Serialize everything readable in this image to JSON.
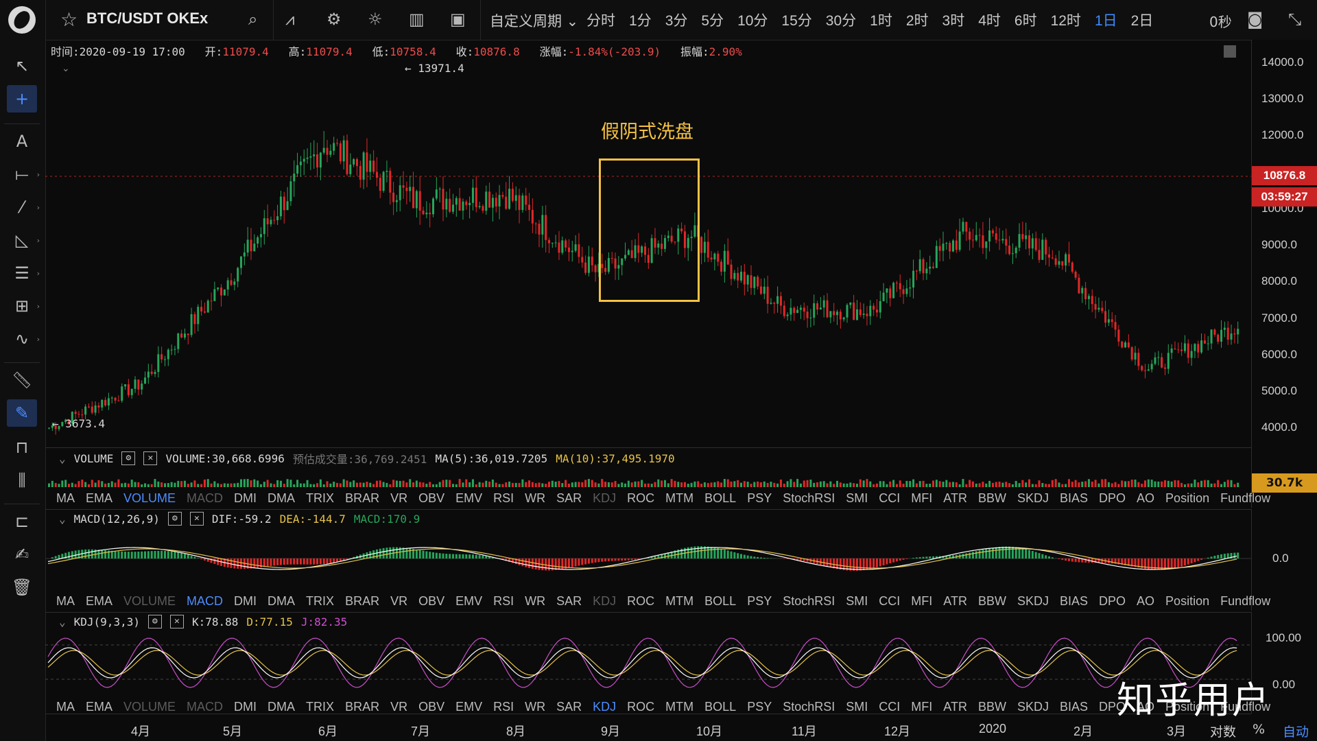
{
  "header": {
    "symbol": "BTC/USDT OKEx",
    "custom_period": "自定义周期 ⌄",
    "periods": [
      "分时",
      "1分",
      "3分",
      "5分",
      "10分",
      "15分",
      "30分",
      "1时",
      "2时",
      "3时",
      "4时",
      "6时",
      "12时",
      "1日",
      "2日"
    ],
    "active_period": "1日",
    "countdown": "0秒"
  },
  "info": {
    "time_label": "时间:",
    "time": "2020-09-19 17:00",
    "open_label": "开:",
    "open": "11079.4",
    "high_label": "高:",
    "high": "11079.4",
    "low_label": "低:",
    "low": "10758.4",
    "close_label": "收:",
    "close": "10876.8",
    "change_label": "涨幅:",
    "change": "-1.84%(-203.9)",
    "amp_label": "振幅:",
    "amp": "2.90%"
  },
  "main": {
    "high_marker": "← 13971.4",
    "low_marker": "← 3673.4",
    "annotation": "假阴式洗盘",
    "price_ticks": [
      "14000.0",
      "13000.0",
      "12000.0",
      "11000.0",
      "10000.0",
      "9000.0",
      "8000.0",
      "7000.0",
      "6000.0",
      "5000.0",
      "4000.0"
    ],
    "last_price": "10876.8",
    "timer": "03:59:27"
  },
  "volume": {
    "name": "VOLUME",
    "value": "VOLUME:30,668.6996",
    "estimate": "预估成交量:36,769.2451",
    "ma5": "MA(5):36,019.7205",
    "ma10": "MA(10):37,495.1970",
    "badge": "30.7k"
  },
  "macd": {
    "name": "MACD(12,26,9)",
    "dif": "DIF:-59.2",
    "dea": "DEA:-144.7",
    "macd": "MACD:170.9",
    "tick": "0.0"
  },
  "kdj": {
    "name": "KDJ(9,3,3)",
    "k": "K:78.88",
    "d": "D:77.15",
    "j": "J:82.35",
    "tick_top": "100.00",
    "tick_mid": "0.00"
  },
  "indicators": [
    "MA",
    "EMA",
    "VOLUME",
    "MACD",
    "DMI",
    "DMA",
    "TRIX",
    "BRAR",
    "VR",
    "OBV",
    "EMV",
    "RSI",
    "WR",
    "SAR",
    "KDJ",
    "ROC",
    "MTM",
    "BOLL",
    "PSY",
    "StochRSI",
    "SMI",
    "CCI",
    "MFI",
    "ATR",
    "BBW",
    "SKDJ",
    "BIAS",
    "DPO",
    "AO",
    "Position",
    "Fundflow"
  ],
  "xaxis": [
    "4月",
    "5月",
    "6月",
    "7月",
    "8月",
    "9月",
    "10月",
    "11月",
    "12月",
    "2020",
    "2月",
    "3月"
  ],
  "footer": {
    "log": "对数",
    "pct": "%",
    "auto": "自动"
  },
  "watermark": "知乎用户",
  "colors": {
    "up": "#26a65b",
    "down": "#e02828",
    "accent": "#4d8dff",
    "highlight": "#f5c242"
  },
  "chart_data": {
    "type": "candlestick",
    "title": "",
    "xlabel": "",
    "ylabel": "",
    "ylim": [
      3500,
      14200
    ],
    "x": [
      "4月",
      "5月",
      "6月",
      "7月",
      "8月",
      "9月",
      "10月",
      "11月",
      "12月",
      "2020",
      "2月",
      "3月"
    ],
    "series": [
      {
        "values": [
          4000,
          5200,
          8200,
          11800,
          10200,
          10400,
          8200,
          9300,
          7300,
          7200,
          9300,
          8800,
          5600,
          6800
        ]
      }
    ],
    "price_max": 13971.4,
    "price_min": 3673.4,
    "last": 10876.8
  }
}
